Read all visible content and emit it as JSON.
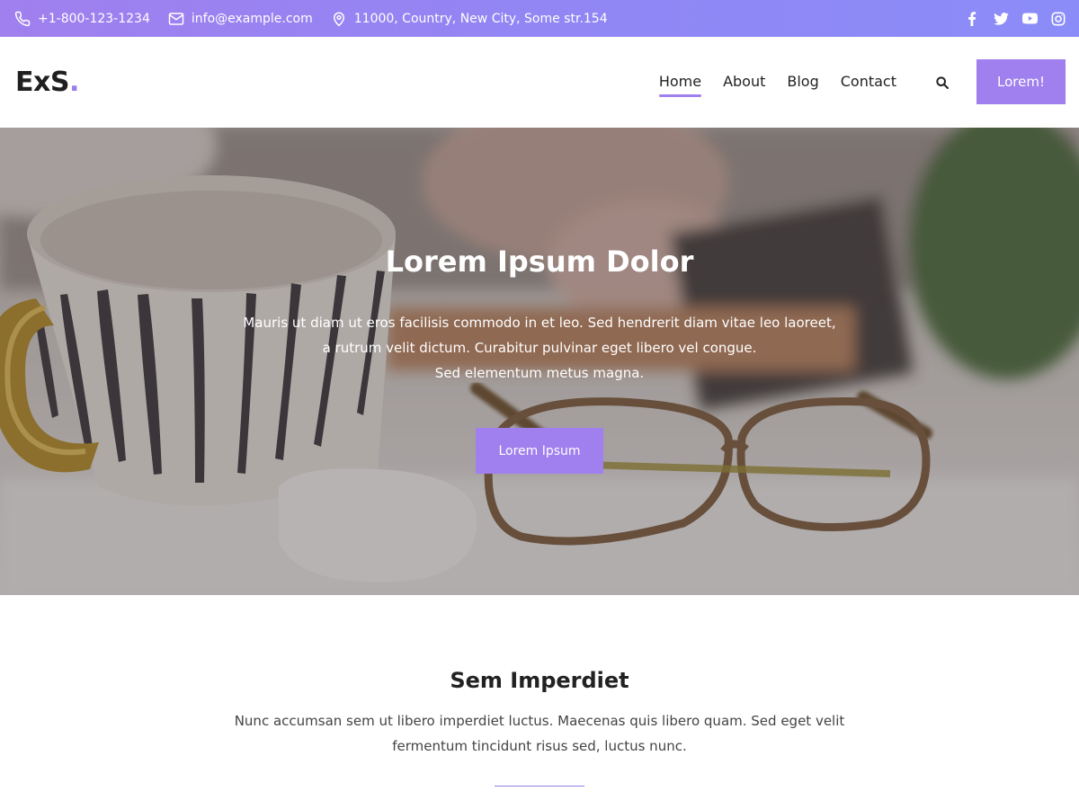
{
  "topbar": {
    "phone": "+1-800-123-1234",
    "email": "info@example.com",
    "address": "11000, Country, New City, Some str.154",
    "social": [
      "facebook-icon",
      "twitter-icon",
      "youtube-icon",
      "instagram-icon"
    ]
  },
  "header": {
    "logo_text": "ExS",
    "logo_dot": ".",
    "nav": [
      {
        "label": "Home",
        "active": true
      },
      {
        "label": "About",
        "active": false
      },
      {
        "label": "Blog",
        "active": false
      },
      {
        "label": "Contact",
        "active": false
      }
    ],
    "cta_label": "Lorem!"
  },
  "hero": {
    "title": "Lorem Ipsum Dolor",
    "text_lines": [
      "Mauris ut diam ut eros facilisis commodo in et leo. Sed hendrerit diam vitae leo laoreet,",
      "a rutrum velit dictum. Curabitur pulvinar eget libero vel congue.",
      "Sed elementum metus magna."
    ],
    "button_label": "Lorem Ipsum"
  },
  "section": {
    "title_light": "Sem",
    "title_bold": "Imperdiet",
    "text": "Nunc accumsan sem ut libero imperdiet luctus. Maecenas quis libero quam. Sed eget velit fermentum tincidunt risus sed, luctus nunc."
  },
  "colors": {
    "accent": "#a07fee",
    "topbar_gradient_end": "#8b8cf8"
  }
}
